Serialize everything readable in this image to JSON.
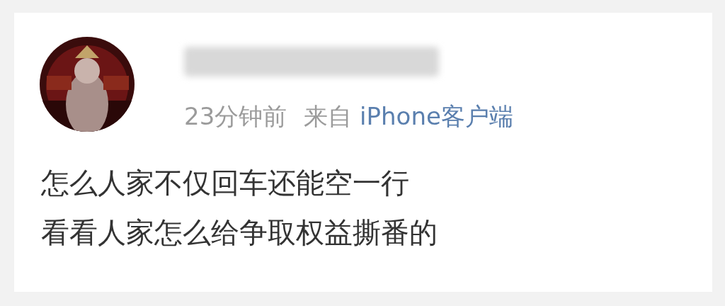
{
  "post": {
    "time": "23分钟前",
    "source_prefix": "来自",
    "source": "iPhone客户端",
    "lines": [
      "怎么人家不仅回车还能空一行",
      "看看人家怎么给争取权益撕番的"
    ]
  }
}
